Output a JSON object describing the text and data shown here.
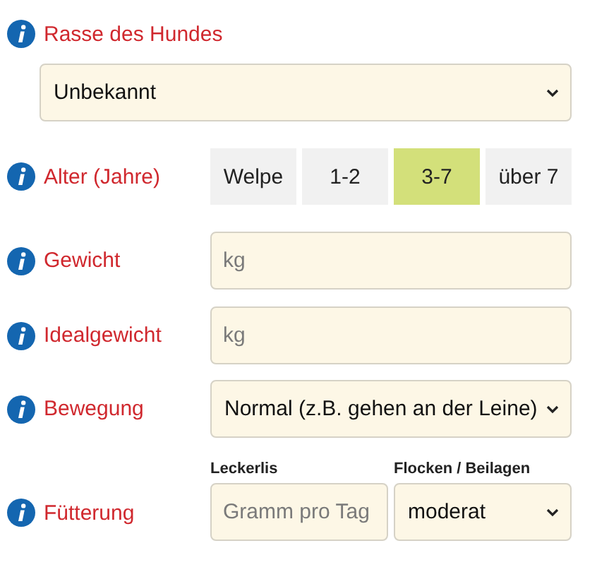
{
  "breed": {
    "label": "Rasse des Hundes",
    "value": "Unbekannt"
  },
  "age": {
    "label": "Alter (Jahre)",
    "options": [
      {
        "label": "Welpe",
        "selected": false
      },
      {
        "label": "1-2",
        "selected": false
      },
      {
        "label": "3-7",
        "selected": true
      },
      {
        "label": "über 7",
        "selected": false
      }
    ]
  },
  "weight": {
    "label": "Gewicht",
    "placeholder": "kg"
  },
  "ideal_weight": {
    "label": "Idealgewicht",
    "placeholder": "kg"
  },
  "activity": {
    "label": "Bewegung",
    "value": "Normal (z.B. gehen an der Leine)"
  },
  "feeding": {
    "label": "Fütterung",
    "treats": {
      "label": "Leckerlis",
      "placeholder": "Gramm pro Tag"
    },
    "flakes": {
      "label": "Flocken / Beilagen",
      "value": "moderat"
    }
  }
}
